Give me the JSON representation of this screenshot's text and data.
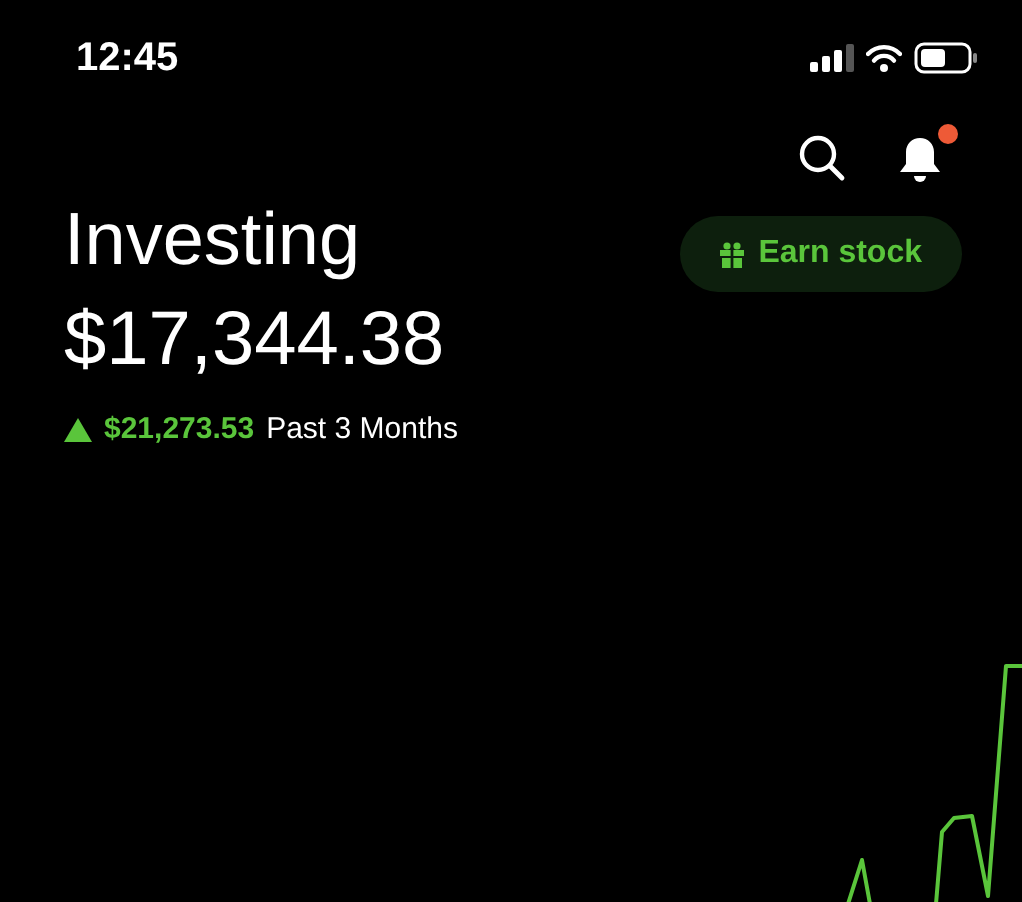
{
  "status_bar": {
    "time": "12:45"
  },
  "header": {
    "notification_badge": true
  },
  "portfolio": {
    "title": "Investing",
    "value": "$17,344.38",
    "change": {
      "positive": true,
      "amount": "$21,273.53",
      "period": "Past 3 Months"
    }
  },
  "earn_button": {
    "label": "Earn stock"
  }
}
